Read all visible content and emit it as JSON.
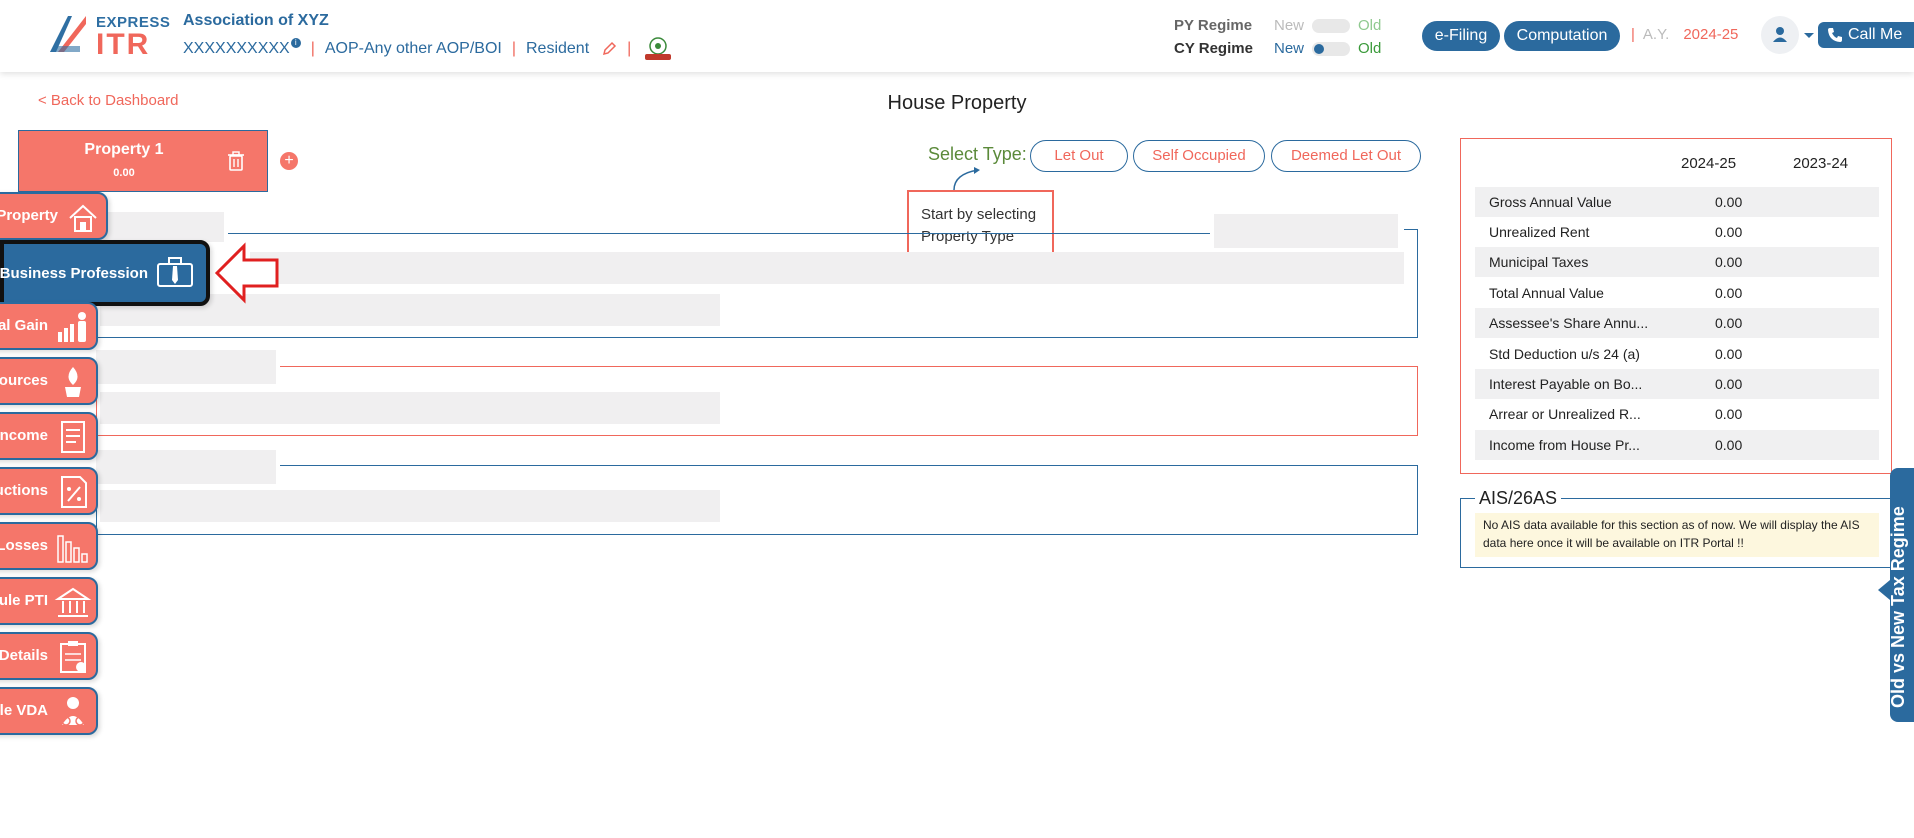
{
  "header": {
    "logo_express": "EXPRESS",
    "logo_itr": "ITR",
    "assessee_name": "Association of XYZ",
    "pan": "XXXXXXXXXX",
    "info_icon": "i",
    "status": "AOP-Any other AOP/BOI",
    "residency": "Resident",
    "regime": {
      "py_label": "PY Regime",
      "py_new": "New",
      "py_old": "Old",
      "cy_label": "CY Regime",
      "cy_new": "New",
      "cy_old": "Old"
    },
    "efiling_label": "e-Filing",
    "computation_label": "Computation",
    "ay_label": "A.Y.",
    "ay_value": "2024-25",
    "call_label": "Call Me"
  },
  "nav": {
    "back_label": "< Back to Dashboard",
    "page_title": "House Property"
  },
  "property": {
    "name": "Property 1",
    "value": "0.00",
    "add_label": "+"
  },
  "select_type": {
    "label": "Select Type:",
    "options": [
      "Let Out",
      "Self Occupied",
      "Deemed Let Out"
    ],
    "tooltip": "Start by selecting Property Type"
  },
  "side_tabs": [
    {
      "label": "Property",
      "icon": "house-icon"
    },
    {
      "label": "Business Profession",
      "icon": "briefcase-icon"
    },
    {
      "label": "al Gain",
      "icon": "growth-chart-icon"
    },
    {
      "label": "ources",
      "icon": "plant-icon"
    },
    {
      "label": "ncome",
      "icon": "tax-document-icon"
    },
    {
      "label": "uctions",
      "icon": "tax-percent-icon"
    },
    {
      "label": "Losses",
      "icon": "declining-chart-icon"
    },
    {
      "label": "ule PTI",
      "icon": "bank-icon"
    },
    {
      "label": "Details",
      "icon": "tax-clipboard-icon"
    },
    {
      "label": "ule VDA",
      "icon": "crypto-person-icon"
    }
  ],
  "summary": {
    "col1": "2024-25",
    "col2": "2023-24",
    "rows": [
      {
        "label": "Gross Annual Value",
        "v1": "0.00",
        "v2": ""
      },
      {
        "label": "Unrealized Rent",
        "v1": "0.00",
        "v2": ""
      },
      {
        "label": "Municipal Taxes",
        "v1": "0.00",
        "v2": ""
      },
      {
        "label": "Total Annual Value",
        "v1": "0.00",
        "v2": ""
      },
      {
        "label": "Assessee's Share Annu...",
        "v1": "0.00",
        "v2": ""
      },
      {
        "label": "Std Deduction u/s 24 (a)",
        "v1": "0.00",
        "v2": ""
      },
      {
        "label": "Interest Payable on Bo...",
        "v1": "0.00",
        "v2": ""
      },
      {
        "label": "Arrear or Unrealized R...",
        "v1": "0.00",
        "v2": ""
      },
      {
        "label": "Income from House Pr...",
        "v1": "0.00",
        "v2": ""
      }
    ]
  },
  "ais": {
    "title": "AIS/26AS",
    "message": "No AIS data available for this section as of now. We will display the AIS data here once it will be available on ITR Portal !!"
  },
  "regime_tab": {
    "label": "Old vs New Tax Regime"
  },
  "colors": {
    "brand_blue": "#2b6a9e",
    "brand_coral": "#f5766a",
    "accent_green": "#5b8a3a"
  }
}
